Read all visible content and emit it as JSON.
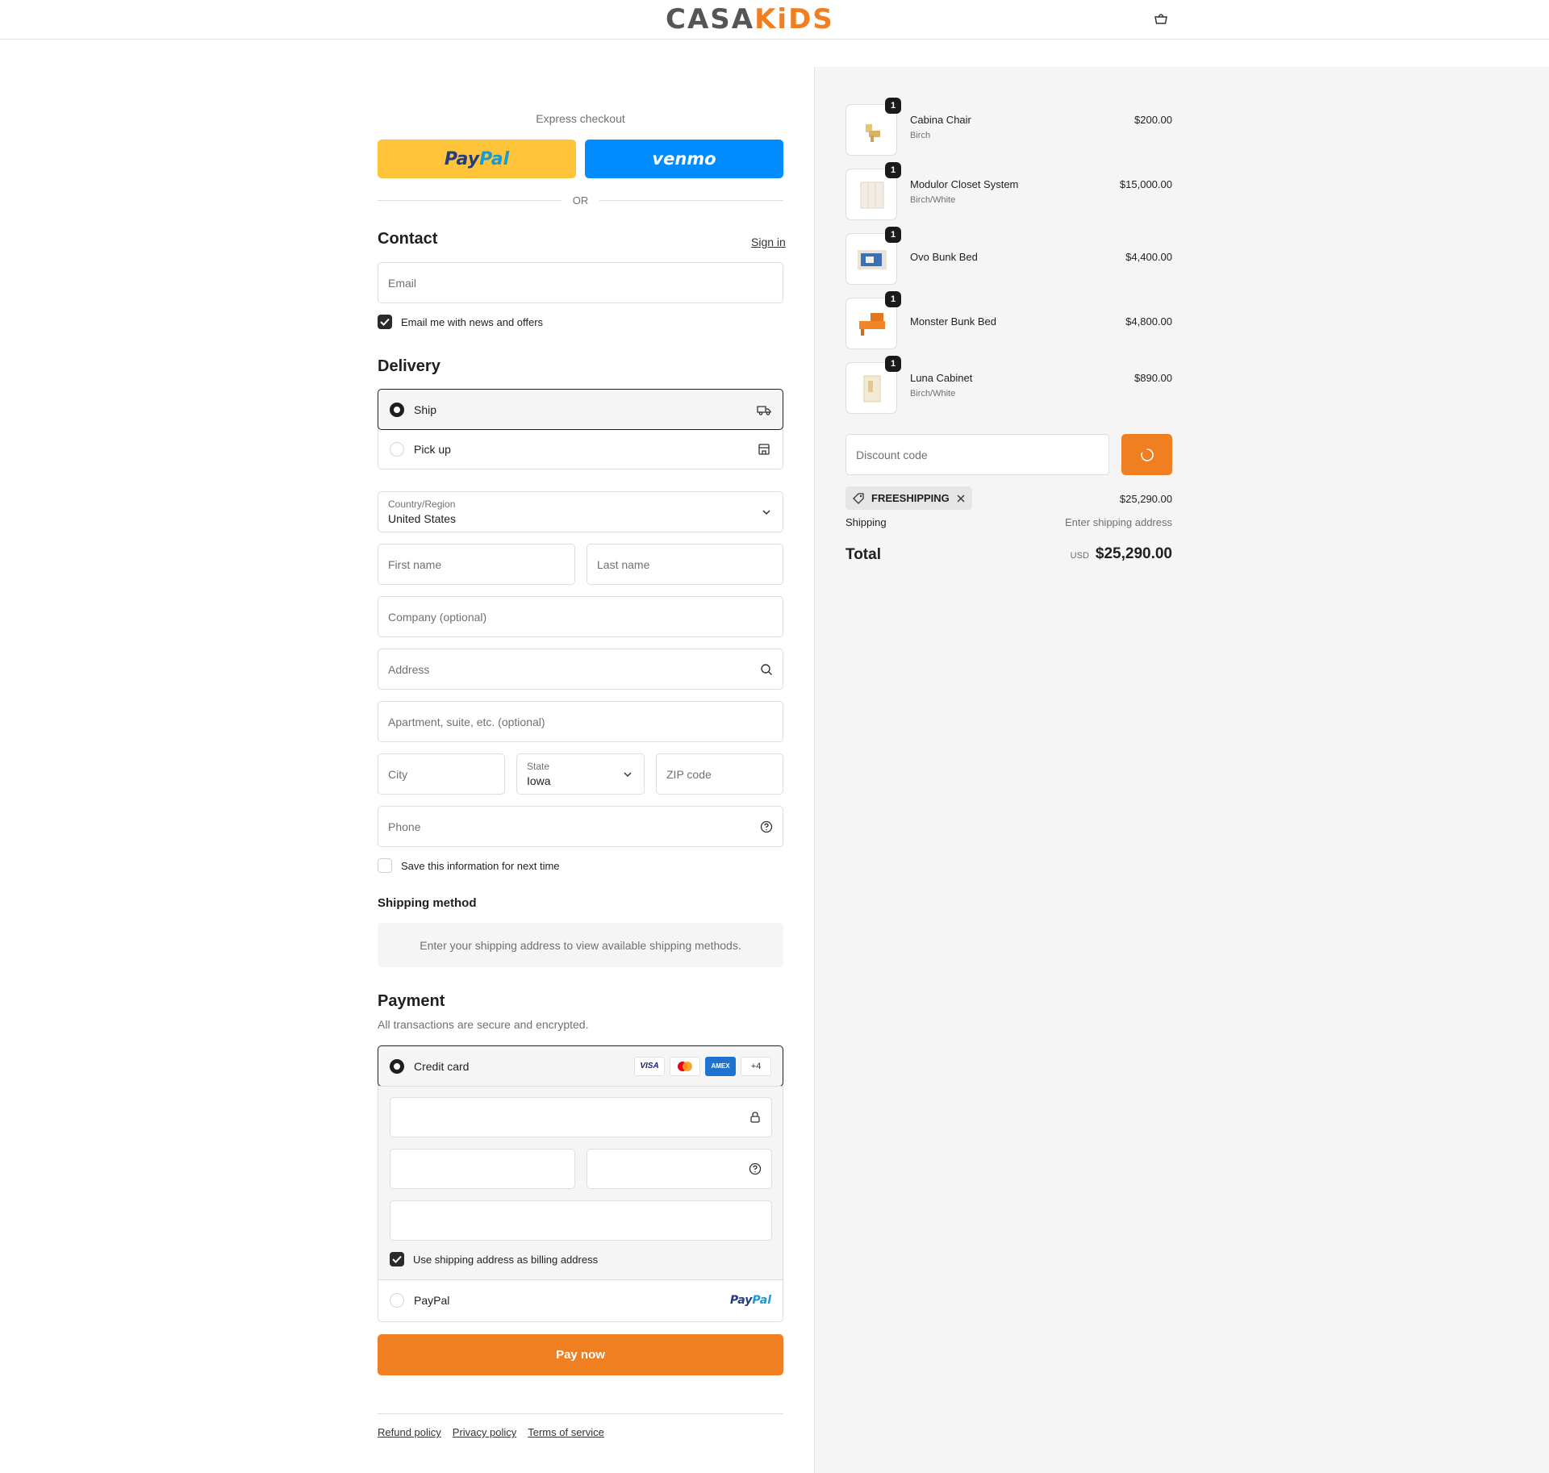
{
  "header": {
    "logo_left": "CASA",
    "logo_right": "KiDS",
    "cart_icon": "bag-icon"
  },
  "express": {
    "label": "Express checkout",
    "paypal_pay": "Pay",
    "paypal_pal": "Pal",
    "venmo": "venmo",
    "or": "OR"
  },
  "contact": {
    "title": "Contact",
    "signin": "Sign in",
    "email_placeholder": "Email",
    "newsletter_label": "Email me with news and offers",
    "newsletter_checked": true
  },
  "delivery": {
    "title": "Delivery",
    "options": [
      {
        "label": "Ship",
        "selected": true,
        "icon": "truck-icon"
      },
      {
        "label": "Pick up",
        "selected": false,
        "icon": "store-icon"
      }
    ],
    "country_label": "Country/Region",
    "country_value": "United States",
    "first_name": "First name",
    "last_name": "Last name",
    "company": "Company (optional)",
    "address": "Address",
    "apartment": "Apartment, suite, etc. (optional)",
    "city": "City",
    "state_label": "State",
    "state_value": "Iowa",
    "zip": "ZIP code",
    "phone": "Phone",
    "save_info": "Save this information for next time"
  },
  "shipping_method": {
    "title": "Shipping method",
    "message": "Enter your shipping address to view available shipping methods."
  },
  "payment": {
    "title": "Payment",
    "subtitle": "All transactions are secure and encrypted.",
    "credit_card_label": "Credit card",
    "card_brands": [
      "VISA",
      "MC",
      "AMEX",
      "+4"
    ],
    "billing_same_label": "Use shipping address as billing address",
    "paypal_label": "PayPal",
    "paypal_logo_pay": "Pay",
    "paypal_logo_pal": "Pal"
  },
  "pay_now": "Pay now",
  "footer": {
    "links": [
      "Refund policy",
      "Privacy policy",
      "Terms of service"
    ]
  },
  "summary": {
    "items": [
      {
        "name": "Cabina Chair",
        "variant": "Birch",
        "price": "$200.00",
        "qty": "1"
      },
      {
        "name": "Modulor Closet System",
        "variant": "Birch/White",
        "price": "$15,000.00",
        "qty": "1"
      },
      {
        "name": "Ovo Bunk Bed",
        "variant": "",
        "price": "$4,400.00",
        "qty": "1"
      },
      {
        "name": "Monster Bunk Bed",
        "variant": "",
        "price": "$4,800.00",
        "qty": "1"
      },
      {
        "name": "Luna Cabinet",
        "variant": "Birch/White",
        "price": "$890.00",
        "qty": "1"
      }
    ],
    "discount_placeholder": "Discount code",
    "applied_code": "FREESHIPPING",
    "subtotal": "$25,290.00",
    "shipping_label": "Shipping",
    "shipping_value": "Enter shipping address",
    "total_label": "Total",
    "currency": "USD",
    "total": "$25,290.00"
  },
  "colors": {
    "brand_orange": "#f07f22",
    "paypal_yellow": "#ffc439",
    "venmo_blue": "#008cff"
  }
}
